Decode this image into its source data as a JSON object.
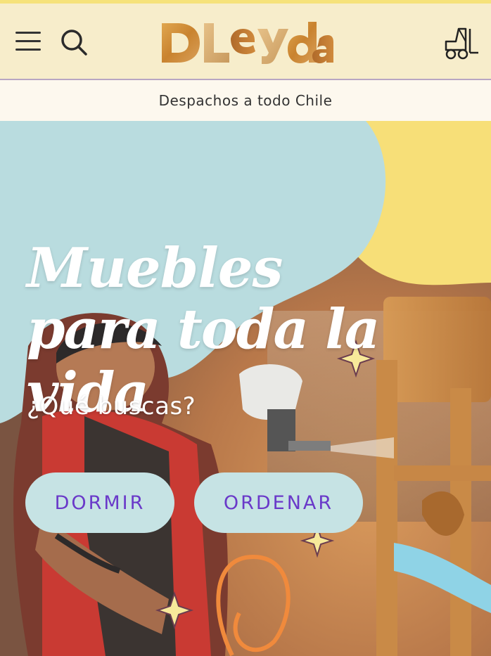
{
  "header": {
    "brand": "Dleyda",
    "menu_icon": "hamburger-menu-icon",
    "search_icon": "search-icon",
    "cart_icon": "forklift-cart-icon"
  },
  "banner": {
    "text": "Despachos a todo Chile"
  },
  "hero": {
    "title_line1": "Muebles",
    "title_line2": "para toda la vida",
    "subtitle": "¿Qué buscas?",
    "buttons": [
      {
        "label": "DORMIR"
      },
      {
        "label": "ORDENAR"
      }
    ]
  },
  "colors": {
    "header_bg": "#f7edcb",
    "banner_bg": "#fdf8ee",
    "hero_blue": "#b9dcdf",
    "hero_yellow": "#f7df78",
    "pill_bg": "#c6e3e4",
    "pill_text": "#6a39c9"
  }
}
